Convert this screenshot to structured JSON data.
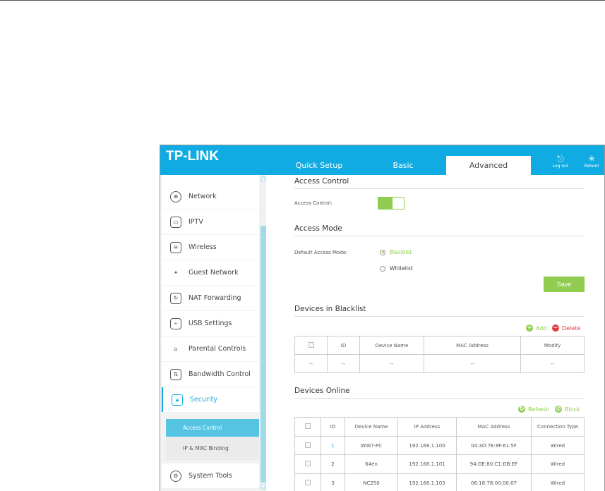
{
  "header": {
    "logo": "TP-LINK",
    "tabs": [
      "Quick Setup",
      "Basic",
      "Advanced"
    ],
    "active_tab": "Advanced",
    "logout": "Log out",
    "reboot": "Reboot"
  },
  "sidebar": {
    "items": [
      {
        "label": "Network",
        "icon": "globe-icon"
      },
      {
        "label": "IPTV",
        "icon": "tv-icon"
      },
      {
        "label": "Wireless",
        "icon": "wireless-icon"
      },
      {
        "label": "Guest Network",
        "icon": "guest-icon"
      },
      {
        "label": "NAT Forwarding",
        "icon": "nat-icon"
      },
      {
        "label": "USB Settings",
        "icon": "usb-icon"
      },
      {
        "label": "Parental Controls",
        "icon": "parental-icon"
      },
      {
        "label": "Bandwidth Control",
        "icon": "bandwidth-icon"
      },
      {
        "label": "Security",
        "icon": "lock-icon"
      }
    ],
    "sub_items": [
      "Access Control",
      "IP & MAC Binding"
    ],
    "last_item": "System Tools"
  },
  "access_control": {
    "title": "Access Control",
    "label": "Access Control:",
    "enabled": true
  },
  "access_mode": {
    "title": "Access Mode",
    "label": "Default Access Mode:",
    "options": [
      "Blacklist",
      "Whitelist"
    ],
    "selected": "Blacklist",
    "save": "Save"
  },
  "blacklist": {
    "title": "Devices in Blacklist",
    "add": "Add",
    "delete": "Delete",
    "columns": [
      "ID",
      "Device Name",
      "MAC Address",
      "Modify"
    ],
    "rows": [
      [
        "--",
        "--",
        "--",
        "--",
        "--"
      ]
    ]
  },
  "online": {
    "title": "Devices Online",
    "refresh": "Refresh",
    "block": "Block",
    "columns": [
      "ID",
      "Device Name",
      "IP Address",
      "MAC Address",
      "Connection Type"
    ],
    "rows": [
      [
        "1",
        "WIN7-PC",
        "192.168.1.100",
        "04:3D:7E:8F:61:5F",
        "Wired"
      ],
      [
        "2",
        "64en",
        "192.168.1.101",
        "94:DE:80:C1:DB:EF",
        "Wired"
      ],
      [
        "3",
        "NC250",
        "192.168.1.103",
        "06:18:78:00:00:07",
        "Wired"
      ]
    ]
  },
  "colors": {
    "brand": "#10abe2",
    "green": "#8fcc4f",
    "red": "#e03a3a"
  }
}
